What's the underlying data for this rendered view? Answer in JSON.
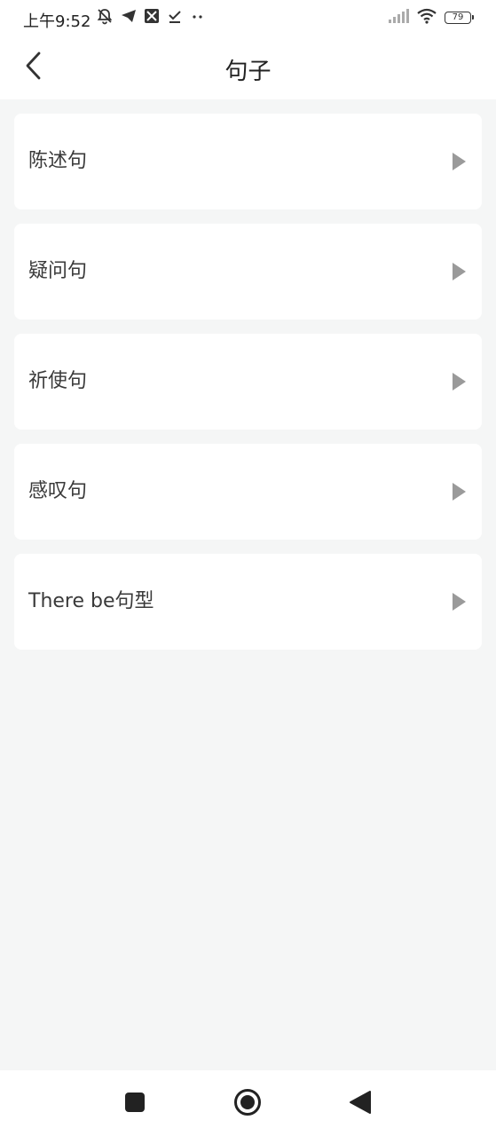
{
  "status_bar": {
    "time": "上午9:52",
    "battery_level": "79",
    "left_icons": [
      "bell-off-icon",
      "telegram-icon",
      "image-icon",
      "check-icon",
      "more-dots-icon"
    ],
    "right_icons": [
      "signal-icon",
      "wifi-icon",
      "battery-icon"
    ]
  },
  "header": {
    "title": "句子",
    "back_icon": "chevron-left-icon"
  },
  "list": {
    "items": [
      {
        "label": "陈述句"
      },
      {
        "label": "疑问句"
      },
      {
        "label": "祈使句"
      },
      {
        "label": "感叹句"
      },
      {
        "label": "There be句型"
      }
    ],
    "arrow_icon": "play-triangle-icon",
    "arrow_color": "#9a9a9a"
  },
  "nav_bar": {
    "buttons": [
      "recent-apps-icon",
      "home-icon",
      "back-triangle-icon"
    ]
  },
  "colors": {
    "background": "#f5f6f6",
    "card": "#ffffff",
    "text": "#3a3a3a"
  }
}
